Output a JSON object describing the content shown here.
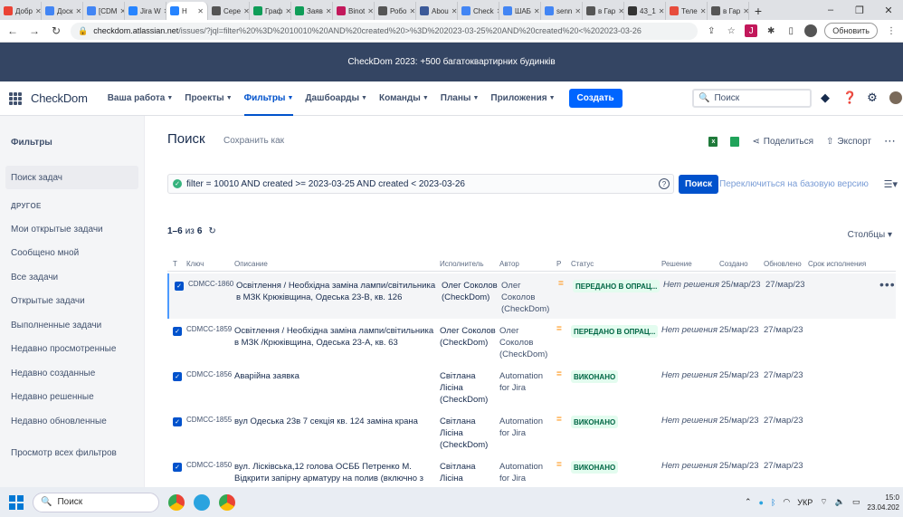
{
  "browser": {
    "tabs": [
      {
        "title": "Добр",
        "color": "#ea4335"
      },
      {
        "title": "Доск",
        "color": "#4285f4"
      },
      {
        "title": "[CDM",
        "color": "#4285f4"
      },
      {
        "title": "Jira W",
        "color": "#2684ff"
      },
      {
        "title": "Н",
        "color": "#2684ff",
        "active": true
      },
      {
        "title": "Сере",
        "color": "#555555"
      },
      {
        "title": "Граф",
        "color": "#0f9d58"
      },
      {
        "title": "Заяв",
        "color": "#0f9d58"
      },
      {
        "title": "Binot",
        "color": "#c2185b"
      },
      {
        "title": "Робо",
        "color": "#555555"
      },
      {
        "title": "Abou",
        "color": "#3b5998"
      },
      {
        "title": "Check",
        "color": "#4285f4"
      },
      {
        "title": "ШАБ",
        "color": "#4285f4"
      },
      {
        "title": "senn",
        "color": "#4285f4"
      },
      {
        "title": "в Гар",
        "color": "#555555"
      },
      {
        "title": "43_1",
        "color": "#333333"
      },
      {
        "title": "Теле",
        "color": "#e74c3c"
      },
      {
        "title": "в Гар",
        "color": "#555555"
      }
    ],
    "url_host": "checkdom.atlassian.net",
    "url_path": "/issues/?jql=filter%20%3D%2010010%20AND%20created%20>%3D%202023-03-25%20AND%20created%20<%202023-03-26",
    "update_label": "Обновить"
  },
  "banner": {
    "text": "CheckDom 2023: +500 багатоквартирних будинків"
  },
  "topnav": {
    "logo": "CheckDom",
    "items": [
      {
        "label": "Ваша работа"
      },
      {
        "label": "Проекты"
      },
      {
        "label": "Фильтры",
        "active": true
      },
      {
        "label": "Дашбоарды"
      },
      {
        "label": "Команды"
      },
      {
        "label": "Планы"
      },
      {
        "label": "Приложения"
      }
    ],
    "create_label": "Создать",
    "search_placeholder": "Поиск"
  },
  "sidebar": {
    "title": "Фильтры",
    "active_item": "Поиск задач",
    "section_heading": "ДРУГОЕ",
    "items": [
      "Мои открытые задачи",
      "Сообщено мной",
      "Все задачи",
      "Открытые задачи",
      "Выполненные задачи",
      "Недавно просмотренные",
      "Недавно созданные",
      "Недавно решенные",
      "Недавно обновленные"
    ],
    "all_filters": "Просмотр всех фильтров"
  },
  "main": {
    "title": "Поиск",
    "save_as": "Сохранить как",
    "share_label": "Поделиться",
    "export_label": "Экспорт",
    "jql": "filter = 10010 AND created >= 2023-03-25 AND created < 2023-03-26",
    "search_button": "Поиск",
    "switch_link": "Переключиться на базовую версию",
    "count_range": "1–6",
    "count_of": "из",
    "count_total": "6",
    "columns_button": "Столбцы",
    "headers": {
      "t": "Т",
      "key": "Ключ",
      "desc": "Описание",
      "assignee": "Исполнитель",
      "author": "Автор",
      "p": "Р",
      "status": "Статус",
      "resolution": "Решение",
      "created": "Создано",
      "updated": "Обновлено",
      "due": "Срок исполнения"
    },
    "rows": [
      {
        "key": "CDMCC-1860",
        "desc": "Освітлення / Необхідна заміна лампи/світильника в МЗК Крюківщина, Одеська 23-В, кв. 126",
        "assignee": "Олег Соколов (CheckDom)",
        "author": "Олег Соколов (CheckDom)",
        "status": "ПЕРЕДАНО В ОПРАЦ...",
        "resolution": "Нет решения",
        "created": "25/мар/23",
        "updated": "27/мар/23"
      },
      {
        "key": "CDMCC-1859",
        "desc": "Освітлення / Необхідна заміна лампи/світильника в МЗК /Крюківщина, Одеська 23-А, кв. 63",
        "assignee": "Олег Соколов (CheckDom)",
        "author": "Олег Соколов (CheckDom)",
        "status": "ПЕРЕДАНО В ОПРАЦ...",
        "resolution": "Нет решения",
        "created": "25/мар/23",
        "updated": "27/мар/23"
      },
      {
        "key": "CDMCC-1856",
        "desc": "Аварійна заявка",
        "assignee": "Світлана Лісіна (CheckDom)",
        "author": "Automation for Jira",
        "status": "ВИКОНАНО",
        "resolution": "Нет решения",
        "created": "25/мар/23",
        "updated": "27/мар/23"
      },
      {
        "key": "CDMCC-1855",
        "desc": "вул Одеська 23в 7 секція кв. 124 заміна крана",
        "assignee": "Світлана Лісіна (CheckDom)",
        "author": "Automation for Jira",
        "status": "ВИКОНАНО",
        "resolution": "Нет решения",
        "created": "25/мар/23",
        "updated": "27/мар/23"
      },
      {
        "key": "CDMCC-1850",
        "desc": "вул. Лісківська,12 голова ОСББ Петренко М. Відкрити запірну арматуру на полив (включно з",
        "assignee": "Світлана Лісіна",
        "author": "Automation for Jira",
        "status": "ВИКОНАНО",
        "resolution": "Нет решения",
        "created": "25/мар/23",
        "updated": "27/мар/23"
      }
    ]
  },
  "taskbar": {
    "search_label": "Поиск",
    "lang": "УКР",
    "time": "15:0",
    "date": "23.04.202"
  }
}
